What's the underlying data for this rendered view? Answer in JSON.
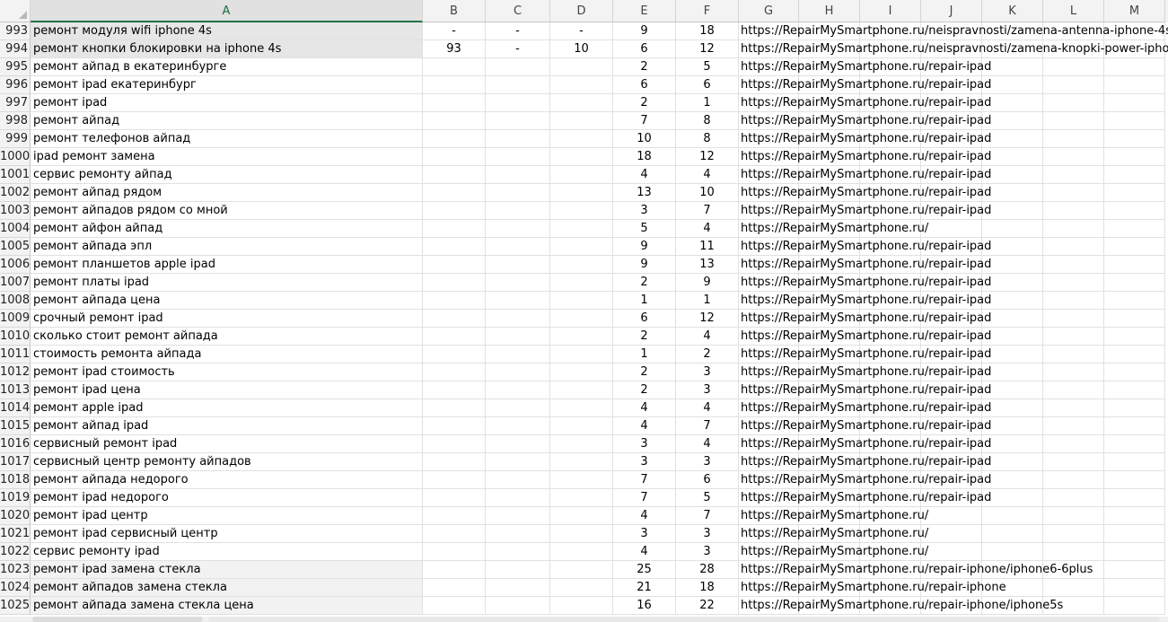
{
  "columns": [
    "A",
    "B",
    "C",
    "D",
    "E",
    "F",
    "G",
    "H",
    "I",
    "J",
    "K",
    "L",
    "M"
  ],
  "active_column": "A",
  "rows": [
    {
      "n": "993",
      "a": "ремонт модуля wifi iphone 4s",
      "b": "-",
      "c": "-",
      "d": "-",
      "e": "9",
      "f": "18",
      "g": "https://RepairMySmartphone.ru/neispravnosti/zamena-antenna-iphone-4s",
      "style": "sel"
    },
    {
      "n": "994",
      "a": "ремонт кнопки блокировки на iphone 4s",
      "b": "93",
      "c": "-",
      "d": "10",
      "e": "6",
      "f": "12",
      "g": "https://RepairMySmartphone.ru/neispravnosti/zamena-knopki-power-iphone",
      "style": "sel"
    },
    {
      "n": "995",
      "a": "ремонт айпад в екатеринбурге",
      "b": "",
      "c": "",
      "d": "",
      "e": "2",
      "f": "5",
      "g": "https://RepairMySmartphone.ru/repair-ipad",
      "style": ""
    },
    {
      "n": "996",
      "a": "ремонт ipad екатеринбург",
      "b": "",
      "c": "",
      "d": "",
      "e": "6",
      "f": "6",
      "g": "https://RepairMySmartphone.ru/repair-ipad",
      "style": ""
    },
    {
      "n": "997",
      "a": "ремонт ipad",
      "b": "",
      "c": "",
      "d": "",
      "e": "2",
      "f": "1",
      "g": "https://RepairMySmartphone.ru/repair-ipad",
      "style": ""
    },
    {
      "n": "998",
      "a": "ремонт айпад",
      "b": "",
      "c": "",
      "d": "",
      "e": "7",
      "f": "8",
      "g": "https://RepairMySmartphone.ru/repair-ipad",
      "style": ""
    },
    {
      "n": "999",
      "a": "ремонт телефонов айпад",
      "b": "",
      "c": "",
      "d": "",
      "e": "10",
      "f": "8",
      "g": "https://RepairMySmartphone.ru/repair-ipad",
      "style": ""
    },
    {
      "n": "1000",
      "a": "ipad ремонт замена",
      "b": "",
      "c": "",
      "d": "",
      "e": "18",
      "f": "12",
      "g": "https://RepairMySmartphone.ru/repair-ipad",
      "style": ""
    },
    {
      "n": "1001",
      "a": "сервис ремонту айпад",
      "b": "",
      "c": "",
      "d": "",
      "e": "4",
      "f": "4",
      "g": "https://RepairMySmartphone.ru/repair-ipad",
      "style": ""
    },
    {
      "n": "1002",
      "a": "ремонт айпад рядом",
      "b": "",
      "c": "",
      "d": "",
      "e": "13",
      "f": "10",
      "g": "https://RepairMySmartphone.ru/repair-ipad",
      "style": ""
    },
    {
      "n": "1003",
      "a": "ремонт айпадов рядом со мной",
      "b": "",
      "c": "",
      "d": "",
      "e": "3",
      "f": "7",
      "g": "https://RepairMySmartphone.ru/repair-ipad",
      "style": ""
    },
    {
      "n": "1004",
      "a": "ремонт айфон айпад",
      "b": "",
      "c": "",
      "d": "",
      "e": "5",
      "f": "4",
      "g": "https://RepairMySmartphone.ru/",
      "style": ""
    },
    {
      "n": "1005",
      "a": "ремонт айпада эпл",
      "b": "",
      "c": "",
      "d": "",
      "e": "9",
      "f": "11",
      "g": "https://RepairMySmartphone.ru/repair-ipad",
      "style": ""
    },
    {
      "n": "1006",
      "a": "ремонт планшетов apple ipad",
      "b": "",
      "c": "",
      "d": "",
      "e": "9",
      "f": "13",
      "g": "https://RepairMySmartphone.ru/repair-ipad",
      "style": ""
    },
    {
      "n": "1007",
      "a": "ремонт платы ipad",
      "b": "",
      "c": "",
      "d": "",
      "e": "2",
      "f": "9",
      "g": "https://RepairMySmartphone.ru/repair-ipad",
      "style": ""
    },
    {
      "n": "1008",
      "a": "ремонт айпада цена",
      "b": "",
      "c": "",
      "d": "",
      "e": "1",
      "f": "1",
      "g": "https://RepairMySmartphone.ru/repair-ipad",
      "style": ""
    },
    {
      "n": "1009",
      "a": "срочный ремонт ipad",
      "b": "",
      "c": "",
      "d": "",
      "e": "6",
      "f": "12",
      "g": "https://RepairMySmartphone.ru/repair-ipad",
      "style": ""
    },
    {
      "n": "1010",
      "a": "сколько стоит ремонт айпада",
      "b": "",
      "c": "",
      "d": "",
      "e": "2",
      "f": "4",
      "g": "https://RepairMySmartphone.ru/repair-ipad",
      "style": ""
    },
    {
      "n": "1011",
      "a": "стоимость ремонта айпада",
      "b": "",
      "c": "",
      "d": "",
      "e": "1",
      "f": "2",
      "g": "https://RepairMySmartphone.ru/repair-ipad",
      "style": ""
    },
    {
      "n": "1012",
      "a": "ремонт ipad стоимость",
      "b": "",
      "c": "",
      "d": "",
      "e": "2",
      "f": "3",
      "g": "https://RepairMySmartphone.ru/repair-ipad",
      "style": ""
    },
    {
      "n": "1013",
      "a": "ремонт ipad цена",
      "b": "",
      "c": "",
      "d": "",
      "e": "2",
      "f": "3",
      "g": "https://RepairMySmartphone.ru/repair-ipad",
      "style": ""
    },
    {
      "n": "1014",
      "a": "ремонт apple ipad",
      "b": "",
      "c": "",
      "d": "",
      "e": "4",
      "f": "4",
      "g": "https://RepairMySmartphone.ru/repair-ipad",
      "style": ""
    },
    {
      "n": "1015",
      "a": "ремонт айпад ipad",
      "b": "",
      "c": "",
      "d": "",
      "e": "4",
      "f": "7",
      "g": "https://RepairMySmartphone.ru/repair-ipad",
      "style": ""
    },
    {
      "n": "1016",
      "a": "сервисный ремонт ipad",
      "b": "",
      "c": "",
      "d": "",
      "e": "3",
      "f": "4",
      "g": "https://RepairMySmartphone.ru/repair-ipad",
      "style": ""
    },
    {
      "n": "1017",
      "a": "сервисный центр ремонту айпадов",
      "b": "",
      "c": "",
      "d": "",
      "e": "3",
      "f": "3",
      "g": "https://RepairMySmartphone.ru/repair-ipad",
      "style": ""
    },
    {
      "n": "1018",
      "a": "ремонт айпада недорого",
      "b": "",
      "c": "",
      "d": "",
      "e": "7",
      "f": "6",
      "g": "https://RepairMySmartphone.ru/repair-ipad",
      "style": ""
    },
    {
      "n": "1019",
      "a": "ремонт ipad недорого",
      "b": "",
      "c": "",
      "d": "",
      "e": "7",
      "f": "5",
      "g": "https://RepairMySmartphone.ru/repair-ipad",
      "style": ""
    },
    {
      "n": "1020",
      "a": "ремонт ipad центр",
      "b": "",
      "c": "",
      "d": "",
      "e": "4",
      "f": "7",
      "g": "https://RepairMySmartphone.ru/",
      "style": ""
    },
    {
      "n": "1021",
      "a": "ремонт ipad сервисный центр",
      "b": "",
      "c": "",
      "d": "",
      "e": "3",
      "f": "3",
      "g": "https://RepairMySmartphone.ru/",
      "style": ""
    },
    {
      "n": "1022",
      "a": "сервис ремонту ipad",
      "b": "",
      "c": "",
      "d": "",
      "e": "4",
      "f": "3",
      "g": "https://RepairMySmartphone.ru/",
      "style": ""
    },
    {
      "n": "1023",
      "a": "ремонт ipad замена стекла",
      "b": "",
      "c": "",
      "d": "",
      "e": "25",
      "f": "28",
      "g": "https://RepairMySmartphone.ru/repair-iphone/iphone6-6plus",
      "style": "gray"
    },
    {
      "n": "1024",
      "a": "ремонт айпадов замена стекла",
      "b": "",
      "c": "",
      "d": "",
      "e": "21",
      "f": "18",
      "g": "https://RepairMySmartphone.ru/repair-iphone",
      "style": "gray"
    },
    {
      "n": "1025",
      "a": "ремонт айпада замена стекла цена",
      "b": "",
      "c": "",
      "d": "",
      "e": "16",
      "f": "22",
      "g": "https://RepairMySmartphone.ru/repair-iphone/iphone5s",
      "style": "gray"
    }
  ]
}
